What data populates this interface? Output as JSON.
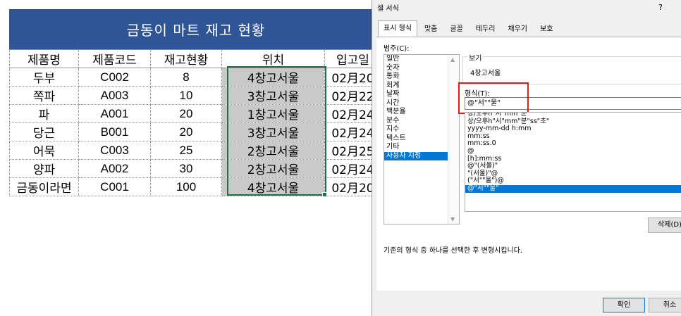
{
  "sheet": {
    "title": "금동이 마트 재고 현황",
    "headers": [
      "제품명",
      "제품코드",
      "재고현황",
      "위치",
      "입고일"
    ],
    "rows": [
      [
        "두부",
        "C002",
        "8",
        "4창고서울",
        "02月20"
      ],
      [
        "쪽파",
        "A003",
        "10",
        "3창고서울",
        "02月22"
      ],
      [
        "파",
        "A001",
        "20",
        "1창고서울",
        "02月24"
      ],
      [
        "당근",
        "B001",
        "20",
        "3창고서울",
        "02月24"
      ],
      [
        "어묵",
        "C003",
        "25",
        "2창고서울",
        "02月25"
      ],
      [
        "양파",
        "A002",
        "30",
        "2창고서울",
        "02月24"
      ],
      [
        "금동이라면",
        "C001",
        "100",
        "4창고서울",
        "02月20"
      ]
    ]
  },
  "dialog": {
    "title": "셀 서식",
    "help": "?",
    "tabs": [
      "표시 형식",
      "맞춤",
      "글꼴",
      "테두리",
      "채우기",
      "보호"
    ],
    "category_label": "범주(C):",
    "categories": [
      "일반",
      "숫자",
      "통화",
      "회계",
      "날짜",
      "시간",
      "백분율",
      "분수",
      "지수",
      "텍스트",
      "기타",
      "사용자 지정"
    ],
    "selected_category": "사용자 지정",
    "preview_label": "보기",
    "preview_value": "4창고서울",
    "type_label": "형식(T):",
    "type_value": "@\"서\"\"울\"",
    "type_list": [
      "상/오후h\"시\"mm\"분\"",
      "상/오후h\"시\"mm\"분\"ss\"초\"",
      "yyyy-mm-dd h:mm",
      "mm:ss",
      "mm:ss.0",
      "@",
      "[h]:mm:ss",
      "@\"(서울)\"",
      "\"(서울)\"@",
      "(\"서\"\"울\")@",
      "@\"서\"\"울\""
    ],
    "selected_type": "@\"서\"\"울\"",
    "delete_button": "삭제(D)",
    "description": "기존의 형식 중 하나를 선택한 후 변형시킵니다.",
    "ok_button": "확인",
    "cancel_button": "취소"
  }
}
